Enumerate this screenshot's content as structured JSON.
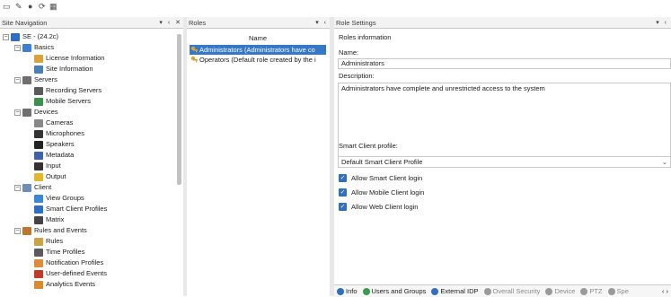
{
  "toolbar": {
    "icons": [
      "save-icon",
      "edit-icon",
      "help-icon",
      "connect-icon",
      "keypad-icon"
    ],
    "glyphs": [
      "▭",
      "✎",
      "●",
      "⟳",
      "▦"
    ]
  },
  "site_nav": {
    "header": "Site Navigation",
    "buttons": "▾ ‹ ✕",
    "tree": [
      {
        "label": "SE - (24.2c)",
        "indent": 0,
        "expander": "⊟",
        "icon": "site-icon",
        "color": "#2f6fc3"
      },
      {
        "label": "Basics",
        "indent": 1,
        "expander": "⊟",
        "icon": "basics-icon",
        "color": "#3d7fd0"
      },
      {
        "label": "License Information",
        "indent": 2,
        "expander": "",
        "icon": "license-icon",
        "color": "#d9a23b"
      },
      {
        "label": "Site Information",
        "indent": 2,
        "expander": "",
        "icon": "site-info-icon",
        "color": "#4c7fb3"
      },
      {
        "label": "Servers",
        "indent": 1,
        "expander": "⊟",
        "icon": "servers-icon",
        "color": "#6f6f6f"
      },
      {
        "label": "Recording Servers",
        "indent": 2,
        "expander": "",
        "icon": "recording-server-icon",
        "color": "#5a5a5a"
      },
      {
        "label": "Mobile Servers",
        "indent": 2,
        "expander": "",
        "icon": "mobile-server-icon",
        "color": "#3c8f4c"
      },
      {
        "label": "Devices",
        "indent": 1,
        "expander": "⊟",
        "icon": "devices-icon",
        "color": "#707070"
      },
      {
        "label": "Cameras",
        "indent": 2,
        "expander": "",
        "icon": "camera-icon",
        "color": "#888888"
      },
      {
        "label": "Microphones",
        "indent": 2,
        "expander": "",
        "icon": "microphone-icon",
        "color": "#333333"
      },
      {
        "label": "Speakers",
        "indent": 2,
        "expander": "",
        "icon": "speaker-icon",
        "color": "#222222"
      },
      {
        "label": "Metadata",
        "indent": 2,
        "expander": "",
        "icon": "metadata-icon",
        "color": "#3e63a8"
      },
      {
        "label": "Input",
        "indent": 2,
        "expander": "",
        "icon": "input-icon",
        "color": "#333333"
      },
      {
        "label": "Output",
        "indent": 2,
        "expander": "",
        "icon": "output-icon",
        "color": "#e3b52a"
      },
      {
        "label": "Client",
        "indent": 1,
        "expander": "⊟",
        "icon": "client-icon",
        "color": "#6d8fb5"
      },
      {
        "label": "View Groups",
        "indent": 2,
        "expander": "",
        "icon": "view-groups-icon",
        "color": "#3a86d6"
      },
      {
        "label": "Smart Client Profiles",
        "indent": 2,
        "expander": "",
        "icon": "smart-client-profiles-icon",
        "color": "#2f6fc3"
      },
      {
        "label": "Matrix",
        "indent": 2,
        "expander": "",
        "icon": "matrix-icon",
        "color": "#444444"
      },
      {
        "label": "Rules and Events",
        "indent": 1,
        "expander": "⊟",
        "icon": "rules-events-icon",
        "color": "#c0762d"
      },
      {
        "label": "Rules",
        "indent": 2,
        "expander": "",
        "icon": "rules-icon",
        "color": "#c9a24a"
      },
      {
        "label": "Time Profiles",
        "indent": 2,
        "expander": "",
        "icon": "time-profiles-icon",
        "color": "#5b5b5b"
      },
      {
        "label": "Notification Profiles",
        "indent": 2,
        "expander": "",
        "icon": "notification-profiles-icon",
        "color": "#e08a3c"
      },
      {
        "label": "User-defined Events",
        "indent": 2,
        "expander": "",
        "icon": "user-defined-events-icon",
        "color": "#c0392b"
      },
      {
        "label": "Analytics Events",
        "indent": 2,
        "expander": "",
        "icon": "analytics-events-icon",
        "color": "#d98a2e"
      }
    ]
  },
  "roles": {
    "header": "Roles",
    "buttons": "▾ ‹",
    "column": "Name",
    "items": [
      {
        "label": "Administrators (Administrators have co",
        "selected": true
      },
      {
        "label": "Operators (Default role created by the i",
        "selected": false
      }
    ]
  },
  "role_settings": {
    "header": "Role Settings",
    "buttons": "▾ ‹",
    "group_title": "Roles information",
    "name_label": "Name:",
    "name_value": "Administrators",
    "description_label": "Description:",
    "description_value": "Administrators have complete and unrestricted access to the system",
    "profile_label": "Smart Client profile:",
    "profile_value": "Default Smart Client Profile",
    "checkboxes": [
      {
        "label": "Allow Smart Client login",
        "checked": true
      },
      {
        "label": "Allow Mobile Client login",
        "checked": true
      },
      {
        "label": "Allow Web Client login",
        "checked": true
      }
    ]
  },
  "bottom_tabs": [
    {
      "label": "Info",
      "icon": "info-icon",
      "color": "#2f6fc3",
      "dim": false
    },
    {
      "label": "Users and Groups",
      "icon": "users-groups-icon",
      "color": "#3c9a4e",
      "dim": false
    },
    {
      "label": "External IDP",
      "icon": "external-idp-icon",
      "color": "#2f6fc3",
      "dim": false
    },
    {
      "label": "Overall Security",
      "icon": "overall-security-icon",
      "color": "#9a9a9a",
      "dim": true
    },
    {
      "label": "Device",
      "icon": "device-icon",
      "color": "#9a9a9a",
      "dim": true
    },
    {
      "label": "PTZ",
      "icon": "ptz-icon",
      "color": "#9a9a9a",
      "dim": true
    },
    {
      "label": "Spe",
      "icon": "speech-icon",
      "color": "#9a9a9a",
      "dim": true
    }
  ],
  "tab_scroll": "‹ ›"
}
